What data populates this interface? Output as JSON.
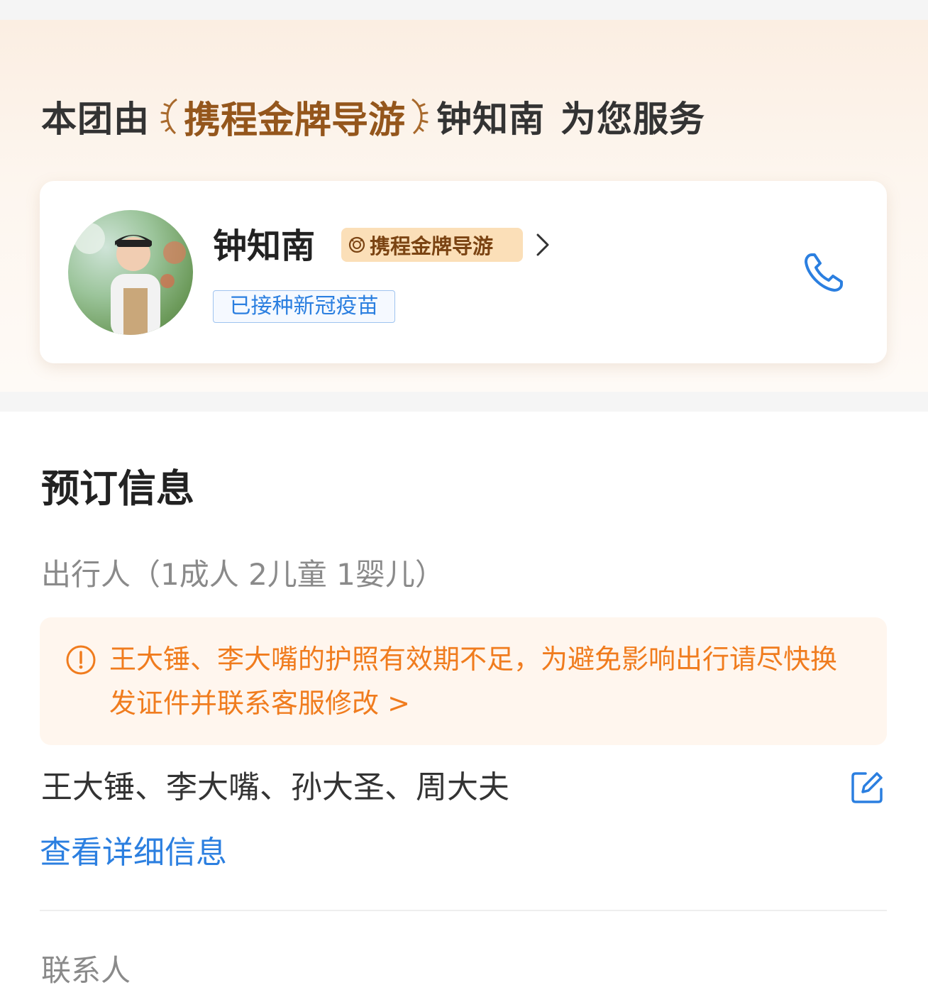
{
  "guide_banner": {
    "prefix": "本团由",
    "badge_text": "携程金牌导游",
    "guide_name": "钟知南",
    "suffix": "为您服务"
  },
  "guide_card": {
    "name": "钟知南",
    "gold_tag": "携程金牌导游",
    "vaccine_tag": "已接种新冠疫苗",
    "icons": [
      "avatar",
      "medal-icon",
      "chevron-right-icon",
      "phone-icon"
    ]
  },
  "booking": {
    "title": "预订信息",
    "travelers_label": "出行人（1成人 2儿童 1婴儿）",
    "alert": "王大锤、李大嘴的护照有效期不足，为避免影响出行请尽快换发证件并联系客服修改 >",
    "travelers": "王大锤、李大嘴、孙大圣、周大夫",
    "detail_link": "查看详细信息",
    "contact_label": "联系人"
  },
  "colors": {
    "accent_blue": "#2b7fe0",
    "warning_orange": "#f07c1e",
    "gold_brown": "#94561c",
    "gold_tag_bg": "#fbdfb8"
  }
}
